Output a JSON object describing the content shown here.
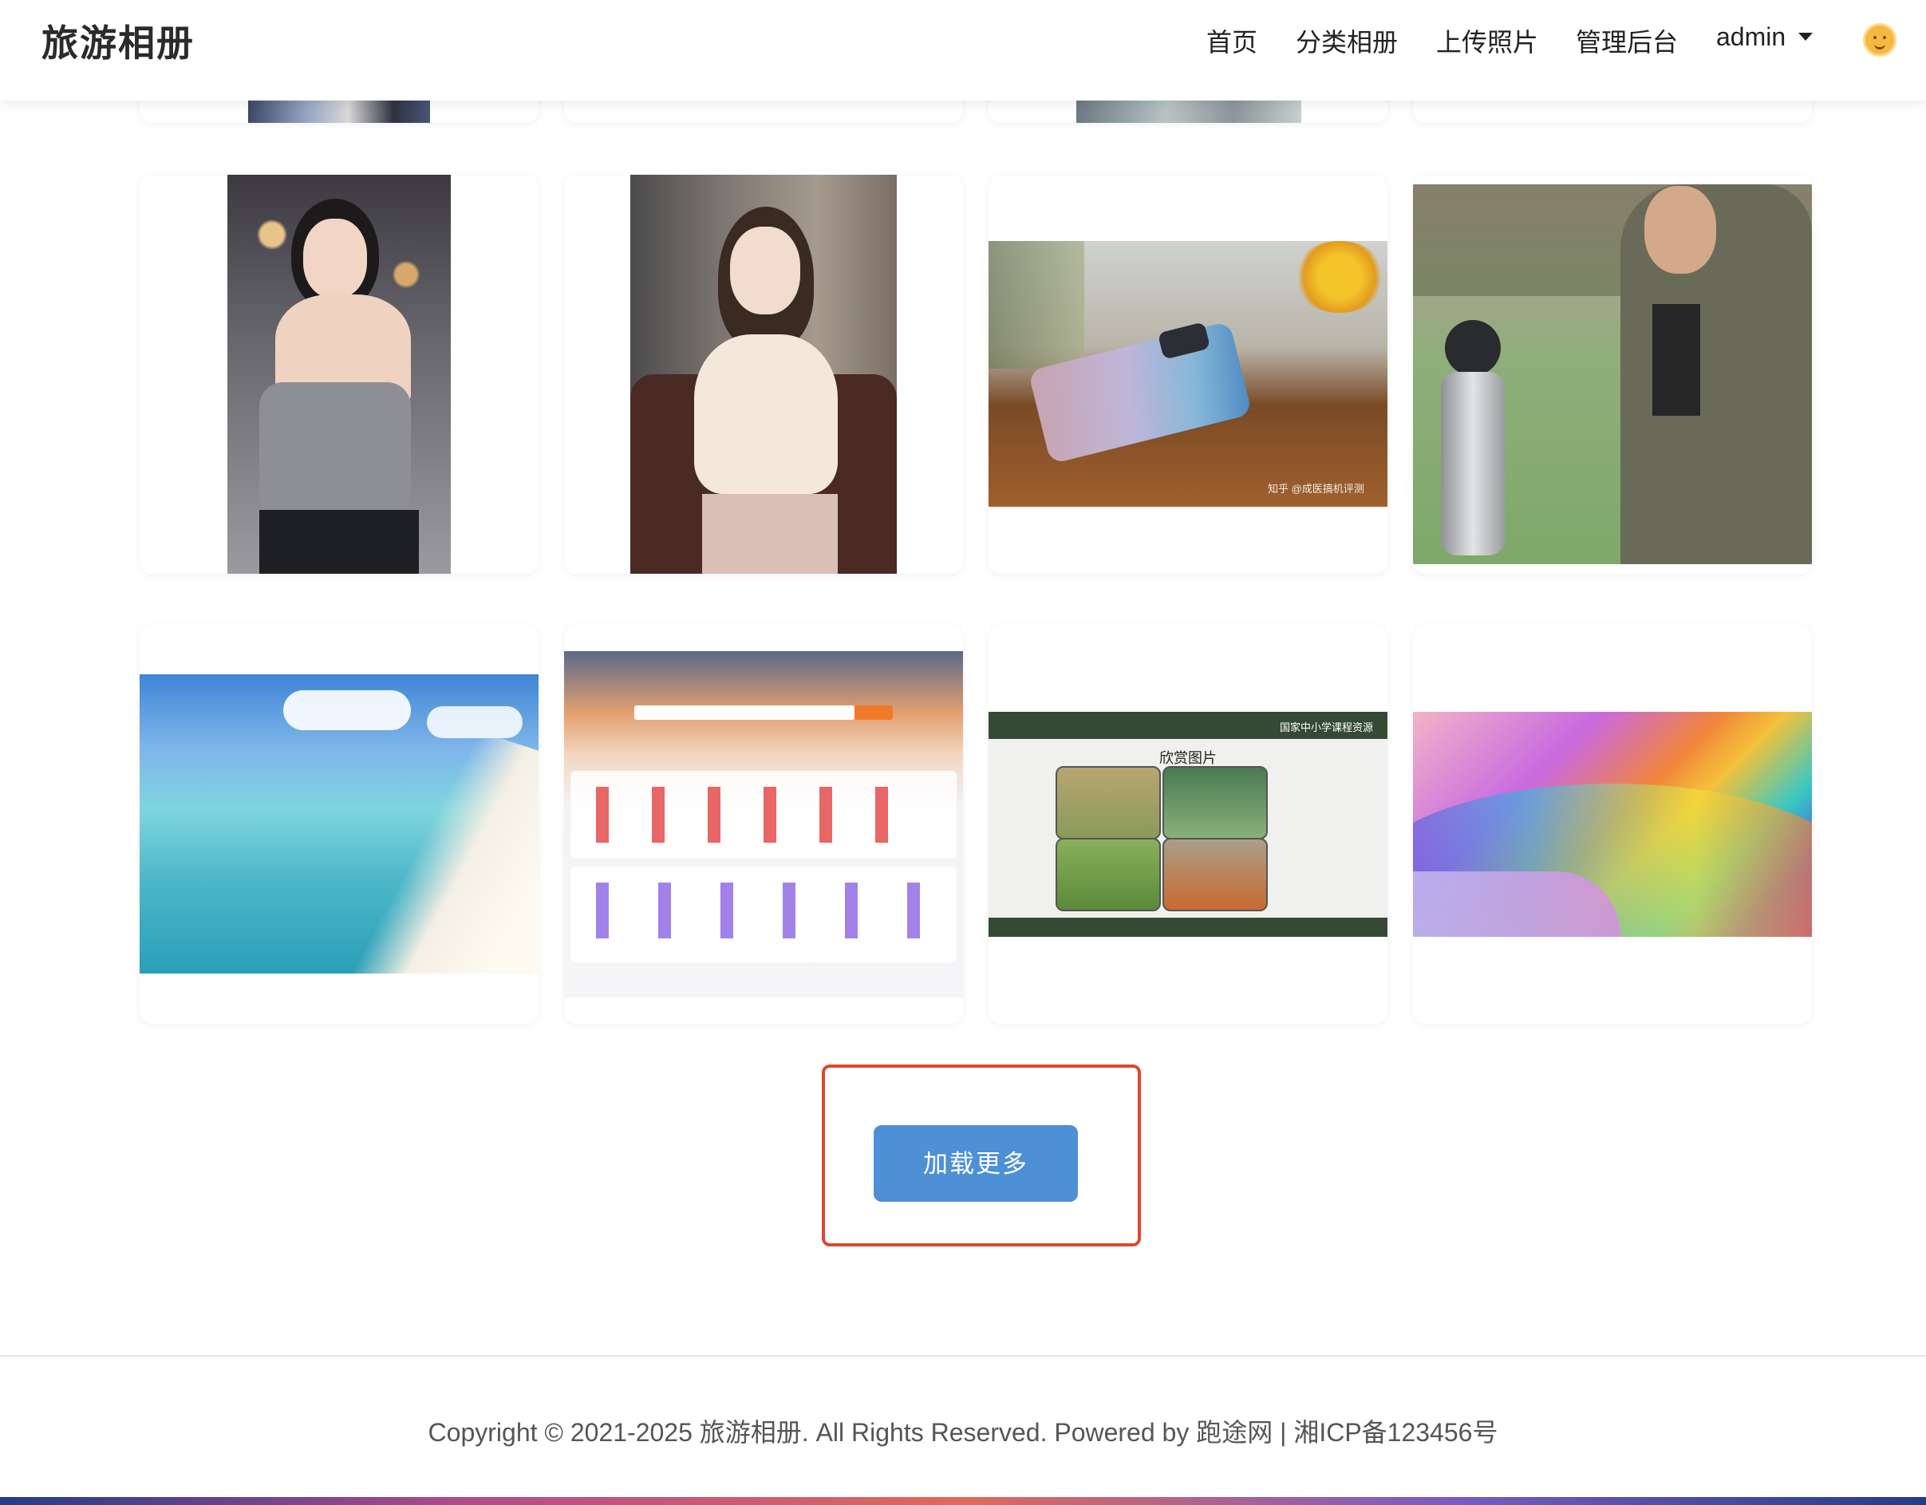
{
  "header": {
    "brand": "旅游相册",
    "nav": [
      "首页",
      "分类相册",
      "上传照片",
      "管理后台"
    ],
    "user": "admin"
  },
  "gallery": {
    "photo3_caption": "知乎 @成医搞机评测",
    "photo7_caption_top": "国家中小学课程资源",
    "photo7_caption_title": "欣赏图片"
  },
  "load_more": "加载更多",
  "footer": "Copyright © 2021-2025 旅游相册. All Rights Reserved. Powered by 跑途网 | 湘ICP备123456号",
  "colors": {
    "accent": "#4d90d6",
    "highlight": "#dd4733"
  },
  "icons": {
    "theme_toggle": "sun-face-icon",
    "user_menu": "caret-down-icon"
  }
}
